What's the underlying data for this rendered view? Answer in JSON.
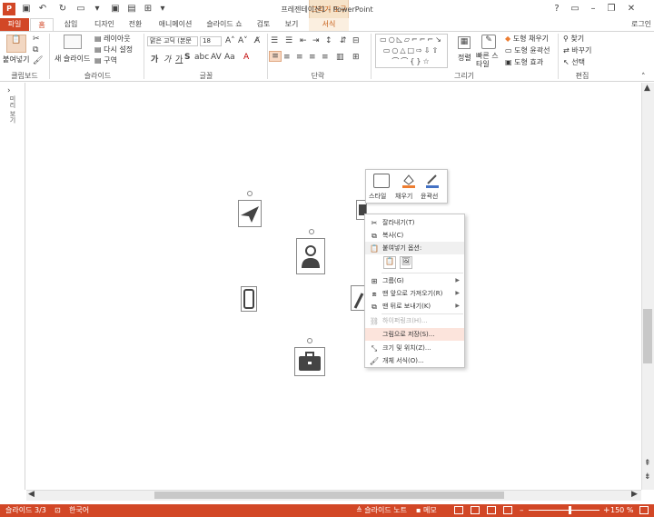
{
  "title_bar": {
    "app_logo": "P",
    "document_title": "프레젠테이션1 - PowerPoint",
    "tool_group": "그리기 도구",
    "login": "로그인"
  },
  "tabs": [
    "파일",
    "홈",
    "삽입",
    "디자인",
    "전환",
    "애니메이션",
    "슬라이드 쇼",
    "검토",
    "보기",
    "서식"
  ],
  "ribbon": {
    "clipboard": {
      "paste": "붙여넣기",
      "label": "클립보드"
    },
    "slides": {
      "new_slide": "새 슬라이드",
      "layout": "레이아웃",
      "reset": "다시 설정",
      "section": "구역",
      "label": "슬라이드"
    },
    "font": {
      "font_name": "맑은 고딕 (본문",
      "font_size": "18",
      "label": "글꼴"
    },
    "paragraph": {
      "label": "단락"
    },
    "drawing": {
      "arrange": "정렬",
      "quick_styles": "빠른 스타일",
      "shape_fill": "도형 채우기",
      "shape_outline": "도형 윤곽선",
      "shape_effects": "도형 효과",
      "label": "그리기"
    },
    "editing": {
      "find": "찾기",
      "replace": "바꾸기",
      "select": "선택",
      "label": "편집"
    }
  },
  "thumbnail_pane_label": "미리 보기",
  "mini_toolbar": {
    "style": "스타일",
    "fill": "채우기",
    "outline": "윤곽선"
  },
  "context_menu": [
    {
      "label": "잘라내기(T)",
      "icon": "scissors-icon",
      "enabled": true
    },
    {
      "label": "복사(C)",
      "icon": "copy-icon",
      "enabled": true
    },
    {
      "label": "붙여넣기 옵션:",
      "icon": "paste-icon",
      "enabled": true,
      "header": true
    },
    {
      "label": "그룹(G)",
      "icon": "group-icon",
      "enabled": true,
      "submenu": true
    },
    {
      "label": "맨 앞으로 가져오기(R)",
      "icon": "bring-front-icon",
      "enabled": true,
      "submenu": true
    },
    {
      "label": "맨 뒤로 보내기(K)",
      "icon": "send-back-icon",
      "enabled": true,
      "submenu": true
    },
    {
      "label": "하이퍼링크(H)...",
      "icon": "hyperlink-icon",
      "enabled": false
    },
    {
      "label": "그림으로 저장(S)...",
      "icon": "",
      "enabled": true,
      "highlighted": true
    },
    {
      "label": "크기 및 위치(Z)...",
      "icon": "size-icon",
      "enabled": true
    },
    {
      "label": "개체 서식(O)...",
      "icon": "format-icon",
      "enabled": true
    }
  ],
  "status_bar": {
    "slide_info": "슬라이드 3/3",
    "language": "한국어",
    "notes": "슬라이드 노트",
    "comments": "메모",
    "zoom": "150 %"
  },
  "colors": {
    "accent": "#d24726",
    "tool_tab": "#f6e3c9",
    "highlight": "#fce4dc"
  }
}
